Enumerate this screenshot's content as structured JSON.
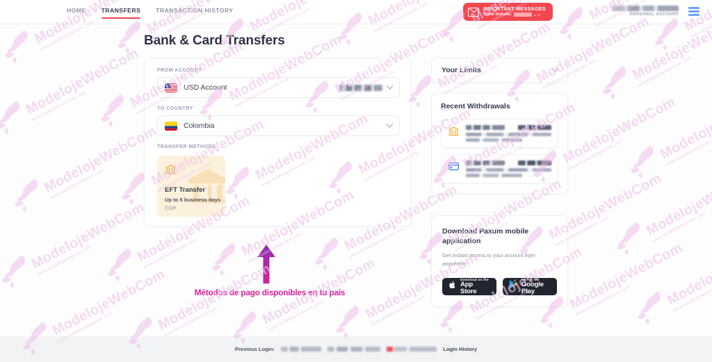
{
  "header": {
    "nav": [
      {
        "label": "HOME",
        "active": false
      },
      {
        "label": "TRANSFERS",
        "active": true
      },
      {
        "label": "TRANSACTION HISTORY",
        "active": false
      }
    ],
    "message_badge": {
      "title": "IMPORTANT MESSAGES",
      "subtitle_prefix": "View tickets:",
      "subtitle_suffix": ", ..."
    },
    "account": {
      "name_redacted": true,
      "type": "PERSONAL ACCOUNT"
    },
    "menu_icon": "hamburger-menu-icon"
  },
  "page": {
    "title": "Bank & Card Transfers"
  },
  "form": {
    "from_account": {
      "label": "FROM ACCOUNT",
      "value": "USD Account",
      "flag": "us-flag-icon",
      "balance_redacted": true,
      "chevron": "chevron-down-icon"
    },
    "to_country": {
      "label": "TO COUNTRY",
      "value": "Colombia",
      "flag": "colombia-flag-icon",
      "chevron": "chevron-down-icon"
    },
    "transfer_methods": {
      "label": "TRANSFER METHODS",
      "items": [
        {
          "name": "EFT Transfer",
          "duration": "Up to 5 business days",
          "currency": "COP",
          "icon": "bank-icon",
          "selected": true
        }
      ]
    }
  },
  "sidebar": {
    "limits": {
      "title": "Your Limits",
      "chevron": "chevron-down-icon"
    },
    "recent_withdrawals": {
      "title": "Recent Withdrawals",
      "items": [
        {
          "icon": "bank-icon",
          "icon_color": "#f7a928",
          "redacted": true
        },
        {
          "icon": "credit-card-icon",
          "icon_color": "#2f80ed",
          "redacted": true
        }
      ]
    },
    "app_promo": {
      "title": "Download Paxum mobile application",
      "subtitle": "Get instant access to your account from anywhere!",
      "buttons": [
        {
          "top": "Download on the",
          "main": "App Store",
          "icon": "apple-icon"
        },
        {
          "top": "GET IT ON",
          "main": "Google Play",
          "icon": "google-play-icon"
        }
      ]
    }
  },
  "annotation": {
    "arrow": "up-arrow-annotation",
    "text": "Métodos de pago disponibles en tu país",
    "text_color": "#d5219c",
    "arrow_gradient": [
      "#8a2fb0",
      "#d5219c"
    ]
  },
  "footer": {
    "label": "Previous Login:",
    "values_redacted": true,
    "link": "Login History"
  },
  "watermarks": {
    "text_big": "ModelojeWebCom",
    "text_small": "www.modelojewebcom.com",
    "color": "#f0c4ec"
  }
}
